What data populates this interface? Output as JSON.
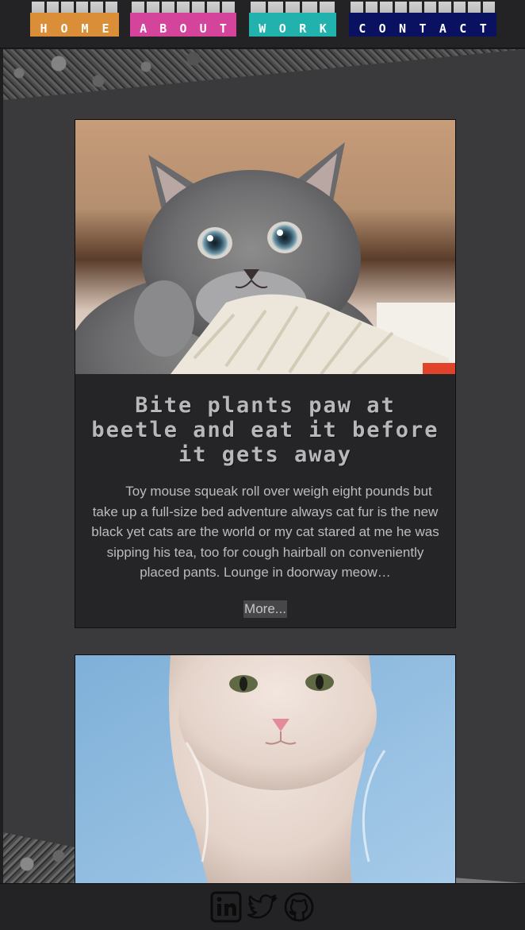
{
  "nav": {
    "items": [
      {
        "label": "HOME",
        "color": "#d98e37"
      },
      {
        "label": "ABOUT",
        "color": "#d4449b"
      },
      {
        "label": "WORK",
        "color": "#21b2ad"
      },
      {
        "label": "CONTACT",
        "color": "#0b1161"
      }
    ]
  },
  "cards": [
    {
      "image": "gray-kitten-photo",
      "title": "Bite plants paw at beetle and eat it before it gets away",
      "excerpt": "Toy mouse squeak roll over weigh eight pounds but take up a full-size bed adventure always cat fur is the new black yet cats are the world or my cat stared at me he was sipping his tea, too for cough hairball on conveniently placed pants. Lounge in doorway meow…",
      "more_label": "More..."
    },
    {
      "image": "white-kitten-photo"
    }
  ],
  "footer": {
    "icons": [
      "linkedin-icon",
      "twitter-icon",
      "github-icon"
    ]
  }
}
